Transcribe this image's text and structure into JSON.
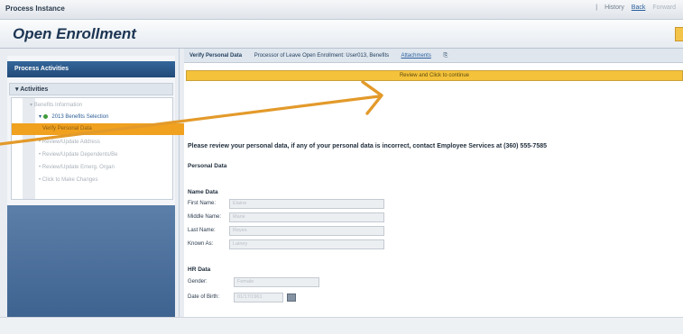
{
  "topbar": {
    "title": "Process Instance",
    "links": [
      {
        "label": "History",
        "style": "plain"
      },
      {
        "label": "Back",
        "style": "link"
      },
      {
        "label": "Forward",
        "style": "dim"
      }
    ]
  },
  "header": {
    "title": "Open Enrollment"
  },
  "left_panel": {
    "header": "Process Activities",
    "activities_label": "Activities",
    "items": [
      {
        "label": "Benefits Information"
      },
      {
        "label": "2013 Benefits Selection"
      },
      {
        "label": "Verify Personal Data",
        "selected": true
      },
      {
        "label": "Review/Update Address"
      },
      {
        "label": "Review/Update Dependents/Be"
      },
      {
        "label": "Review/Update Emerg. Organ"
      },
      {
        "label": "Click to Make Changes"
      }
    ]
  },
  "main": {
    "crumbs": {
      "current": "Verify Personal Data",
      "context": "Processor of Leave Open Enrollment: User013, Benefits",
      "attachments": "Attachments"
    },
    "banner": "Review and Click to continue",
    "instruction": "Please review your personal data, if any of your personal data is incorrect, contact Employee Services at (360) 555-7585",
    "personal_data_heading": "Personal Data",
    "name_section": {
      "heading": "Name Data",
      "fields": [
        {
          "label": "First Name:",
          "value": "Elaine"
        },
        {
          "label": "Middle Name:",
          "value": "Marie"
        },
        {
          "label": "Last Name:",
          "value": "Reyes"
        },
        {
          "label": "Known As:",
          "value": "Lainey"
        }
      ]
    },
    "hr_section": {
      "heading": "HR Data",
      "fields": [
        {
          "label": "Gender:",
          "value": "Female"
        },
        {
          "label": "Date of Birth:",
          "value": "01/17/1961"
        }
      ]
    }
  },
  "colors": {
    "accent_orange": "#e39a2a",
    "banner_yellow": "#f5c33b",
    "brand_blue": "#214a78"
  }
}
